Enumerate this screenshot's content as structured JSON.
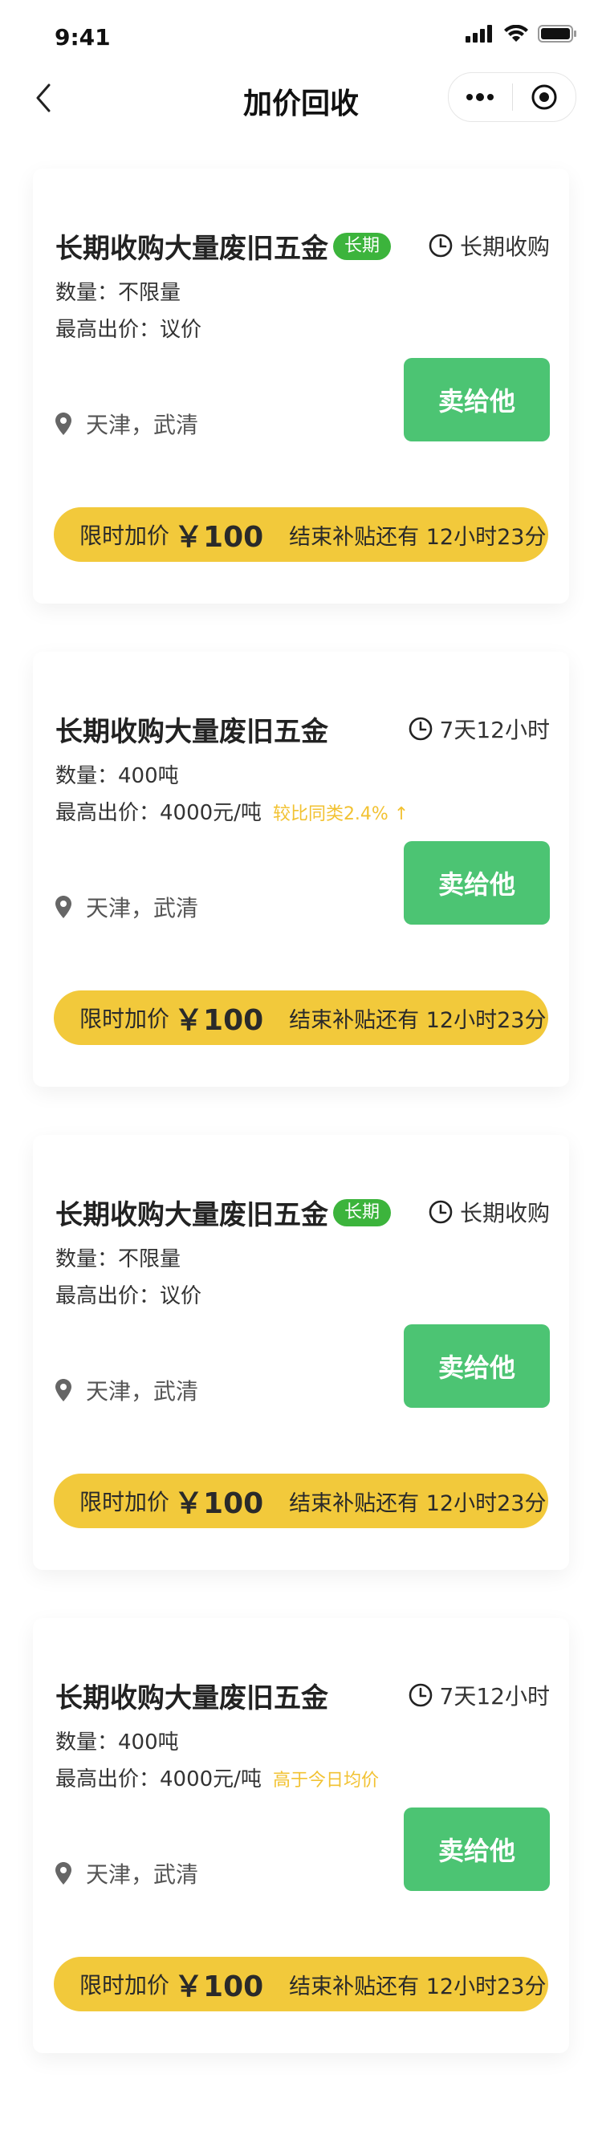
{
  "status_bar": {
    "time": "9:41"
  },
  "nav": {
    "title": "加价回收"
  },
  "cards": [
    {
      "title": "长期收购大量废旧五金",
      "tag": "长期",
      "deadline": "长期收购",
      "quantity": "数量：不限量",
      "price": "最高出价：议价",
      "price_note": "",
      "location": "天津，武清",
      "sell_label": "卖给他",
      "promo_label": "限时加价",
      "promo_amount": "￥100",
      "promo_countdown": "结束补贴还有 12小时23分"
    },
    {
      "title": "长期收购大量废旧五金",
      "tag": "",
      "deadline": "7天12小时",
      "quantity": "数量：400吨",
      "price": "最高出价：4000元/吨",
      "price_note": "较比同类2.4% ↑",
      "location": "天津，武清",
      "sell_label": "卖给他",
      "promo_label": "限时加价",
      "promo_amount": "￥100",
      "promo_countdown": "结束补贴还有 12小时23分"
    },
    {
      "title": "长期收购大量废旧五金",
      "tag": "长期",
      "deadline": "长期收购",
      "quantity": "数量：不限量",
      "price": "最高出价：议价",
      "price_note": "",
      "location": "天津，武清",
      "sell_label": "卖给他",
      "promo_label": "限时加价",
      "promo_amount": "￥100",
      "promo_countdown": "结束补贴还有 12小时23分"
    },
    {
      "title": "长期收购大量废旧五金",
      "tag": "",
      "deadline": "7天12小时",
      "quantity": "数量：400吨",
      "price": "最高出价：4000元/吨",
      "price_note": "高于今日均价",
      "location": "天津，武清",
      "sell_label": "卖给他",
      "promo_label": "限时加价",
      "promo_amount": "￥100",
      "promo_countdown": "结束补贴还有 12小时23分"
    }
  ],
  "colors": {
    "accent_green": "#4cc473",
    "tag_green": "#3cb43c",
    "promo_yellow": "#f2c93b",
    "note_yellow": "#f2c232"
  },
  "icons": {
    "back": "chevron-left-icon",
    "more": "more-dots-icon",
    "close": "target-circle-icon",
    "clock": "clock-icon",
    "location": "location-pin-icon"
  }
}
